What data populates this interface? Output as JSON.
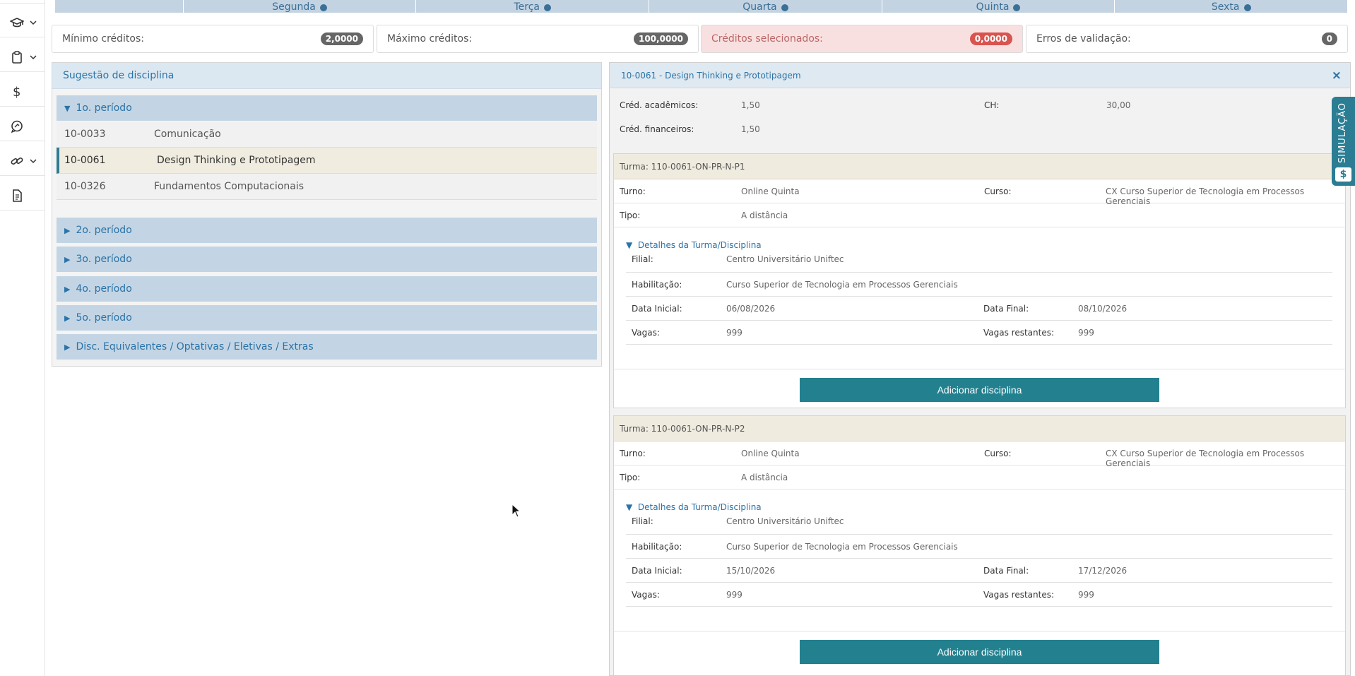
{
  "rail": {
    "items": [
      {
        "icon": "graduation-cap-icon",
        "has_chevron": true
      },
      {
        "icon": "clipboard-icon",
        "has_chevron": true
      },
      {
        "icon": "dollar-icon",
        "label": "$",
        "has_chevron": false
      },
      {
        "icon": "chat-icon",
        "has_chevron": false
      },
      {
        "icon": "link-icon",
        "has_chevron": true
      },
      {
        "icon": "document-icon",
        "has_chevron": false
      }
    ]
  },
  "weekdays": [
    "",
    "Segunda",
    "Terça",
    "Quarta",
    "Quinta",
    "Sexta"
  ],
  "credits": {
    "min_label": "Mínimo créditos:",
    "min_value": "2,0000",
    "max_label": "Máximo créditos:",
    "max_value": "100,0000",
    "selected_label": "Créditos selecionados:",
    "selected_value": "0,0000",
    "errors_label": "Erros de validação:",
    "errors_value": "0"
  },
  "suggestion": {
    "title": "Sugestão de disciplina",
    "open_period": "1o. período",
    "disciplines": [
      {
        "code": "10-0033",
        "name": "Comunicação"
      },
      {
        "code": "10-0061",
        "name": "Design Thinking e Prototipagem"
      },
      {
        "code": "10-0326",
        "name": "Fundamentos Computacionais"
      }
    ],
    "collapsed_periods": [
      "2o. período",
      "3o. período",
      "4o. período",
      "5o. período",
      "Disc. Equivalentes / Optativas / Eletivas / Extras"
    ]
  },
  "detail": {
    "title": "10-0061 - Design Thinking e Prototipagem",
    "close": "×",
    "acad_label": "Créd. acadêmicos:",
    "acad_value": "1,50",
    "ch_label": "CH:",
    "ch_value": "30,00",
    "fin_label": "Créd. financeiros:",
    "fin_value": "1,50",
    "turmas": [
      {
        "title": "Turma: 110-0061-ON-PR-N-P1",
        "turno_label": "Turno:",
        "turno": "Online Quinta",
        "curso_label": "Curso:",
        "curso": "CX Curso Superior de Tecnologia em Processos Gerenciais",
        "tipo_label": "Tipo:",
        "tipo": "A distância",
        "details_label": "Detalhes da Turma/Disciplina",
        "filial_label": "Filial:",
        "filial": "Centro Universitário Uniftec",
        "hab_label": "Habilitação:",
        "hab": "Curso Superior de Tecnologia em Processos Gerenciais",
        "di_label": "Data Inicial:",
        "di": "06/08/2026",
        "df_label": "Data Final:",
        "df": "08/10/2026",
        "vagas_label": "Vagas:",
        "vagas": "999",
        "vr_label": "Vagas restantes:",
        "vr": "999",
        "button": "Adicionar disciplina"
      },
      {
        "title": "Turma: 110-0061-ON-PR-N-P2",
        "turno_label": "Turno:",
        "turno": "Online Quinta",
        "curso_label": "Curso:",
        "curso": "CX Curso Superior de Tecnologia em Processos Gerenciais",
        "tipo_label": "Tipo:",
        "tipo": "A distância",
        "details_label": "Detalhes da Turma/Disciplina",
        "filial_label": "Filial:",
        "filial": "Centro Universitário Uniftec",
        "hab_label": "Habilitação:",
        "hab": "Curso Superior de Tecnologia em Processos Gerenciais",
        "di_label": "Data Inicial:",
        "di": "15/10/2026",
        "df_label": "Data Final:",
        "df": "17/12/2026",
        "vagas_label": "Vagas:",
        "vagas": "999",
        "vr_label": "Vagas restantes:",
        "vr": "999",
        "button": "Adicionar disciplina"
      }
    ]
  },
  "sim_tab": {
    "label": "SIMULAÇÃO",
    "dollar": "$"
  },
  "colors": {
    "accent": "#23808f",
    "link": "#2b73a8",
    "period_bg": "#c3d5e4",
    "danger_bg": "#f9e0e0"
  }
}
